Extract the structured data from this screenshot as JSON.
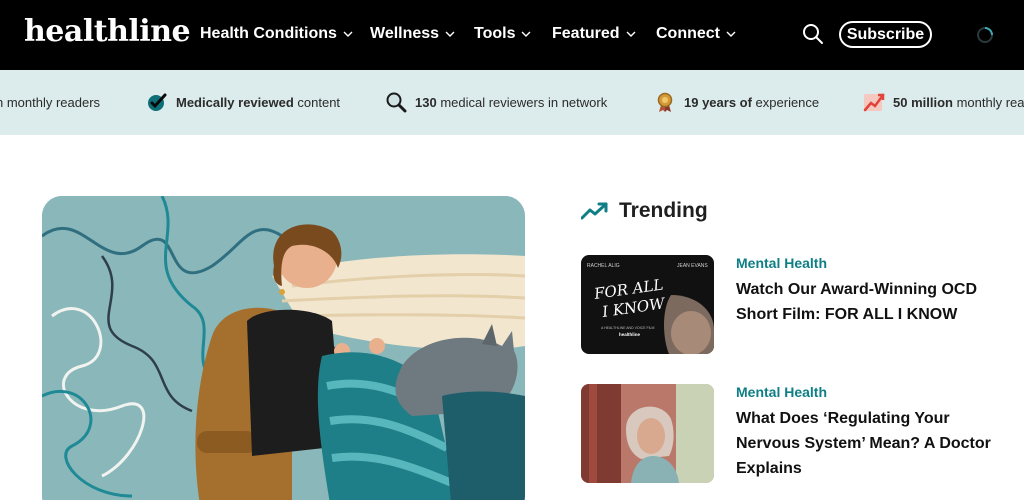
{
  "header": {
    "logo": "healthline",
    "nav": [
      {
        "label": "Health Conditions",
        "icon": "chevron-down-icon"
      },
      {
        "label": "Wellness",
        "icon": "chevron-down-icon"
      },
      {
        "label": "Tools",
        "icon": "chevron-down-icon"
      },
      {
        "label": "Featured",
        "icon": "chevron-down-icon"
      },
      {
        "label": "Connect",
        "icon": "chevron-down-icon"
      }
    ],
    "search_icon": "search-icon",
    "subscribe_label": "Subscribe",
    "loading_icon": "loading-spinner-icon"
  },
  "trust_bar": {
    "items": [
      {
        "bold": "",
        "text": "n monthly readers",
        "icon": ""
      },
      {
        "bold": "Medically reviewed",
        "text": " content",
        "icon": "checkmark-badge-icon"
      },
      {
        "bold": "130",
        "text": " medical reviewers in network",
        "icon": "magnifier-icon"
      },
      {
        "bold": "19 years of",
        "text": " experience",
        "icon": "award-ribbon-icon"
      },
      {
        "bold": "50 million",
        "text": " monthly rea",
        "icon": "trend-graph-icon"
      }
    ],
    "colors": {
      "background": "#dcebeb",
      "icon_teal": "#0e6f78"
    }
  },
  "hero": {
    "image": "woman-knitting-illustration",
    "colors": {
      "background": "#8ab7b9",
      "yarn": "#1f8a95"
    }
  },
  "trending": {
    "title": "Trending",
    "icon": "trending-arrow-icon",
    "articles": [
      {
        "category": "Mental Health",
        "title": "Watch Our Award-Winning OCD Short Film: FOR ALL I KNOW",
        "thumb": {
          "credit_left": "RACHEL ALIG",
          "credit_right": "JEAN EVANS",
          "title_line1": "FOR ALL",
          "title_line2": "I KNOW",
          "caption": "A HEALTHLINE AND VOICE FILM",
          "brand": "healthline"
        }
      },
      {
        "category": "Mental Health",
        "title": "What Does ‘Regulating Your Nervous System’ Mean? A Doctor Explains",
        "thumb": {
          "image": "woman-by-window-photo"
        }
      }
    ],
    "colors": {
      "category": "#0f7f86"
    }
  }
}
